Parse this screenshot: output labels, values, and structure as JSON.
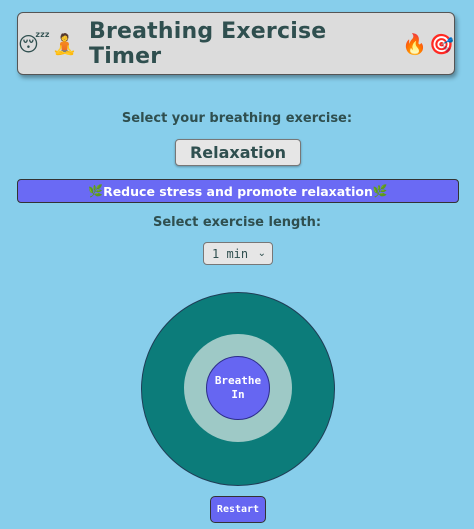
{
  "header": {
    "title": "Breathing Exercise Timer",
    "emoji_left_1": "😴",
    "emoji_left_2": "🧘",
    "emoji_right_1": "🔥",
    "emoji_right_2": "🎯"
  },
  "exercise": {
    "prompt": "Select your breathing exercise:",
    "selected_label": "Relaxation",
    "description": "Reduce stress and promote relaxation",
    "description_icon": "🌿"
  },
  "length": {
    "prompt": "Select exercise length:",
    "selected_value": "1 min"
  },
  "breathing": {
    "instruction_line1": "Breathe",
    "instruction_line2": "In"
  },
  "controls": {
    "restart_label": "Restart"
  },
  "colors": {
    "background": "#87ceeb",
    "accent": "#6666f2",
    "outer_circle": "#0c7c7a",
    "middle_circle": "#9ec9c6"
  }
}
